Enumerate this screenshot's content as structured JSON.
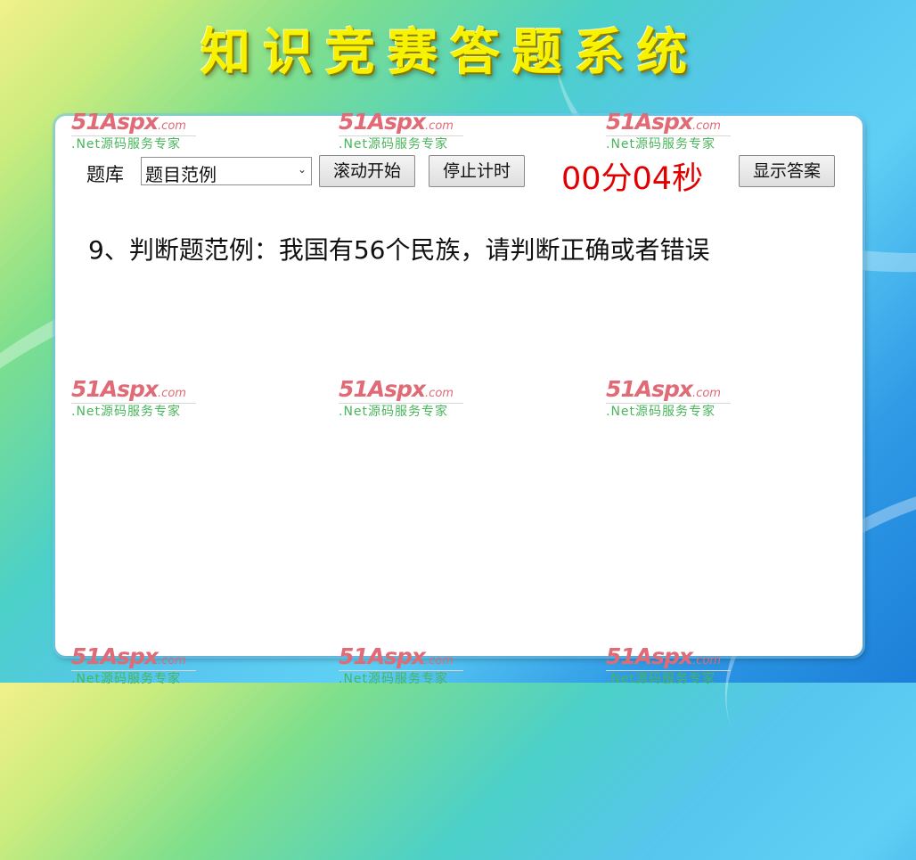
{
  "app_title": "知识竞赛答题系统",
  "watermark": {
    "brand": "51Aspx",
    "suffix": ".com",
    "tagline": ".Net源码服务专家"
  },
  "toolbar": {
    "bank_label": "题库",
    "bank_select_value": "题目范例",
    "start_scroll_label": "滚动开始",
    "stop_timer_label": "停止计时",
    "show_answer_label": "显示答案"
  },
  "timer": {
    "display": "00分04秒",
    "color": "#e00000"
  },
  "question": {
    "text": "9、判断题范例：我国有56个民族，请判断正确或者错误"
  },
  "colors": {
    "title": "#f6f200",
    "panel": "#ffffff",
    "watermark_red": "#e06a76",
    "watermark_green": "#48b65a"
  }
}
